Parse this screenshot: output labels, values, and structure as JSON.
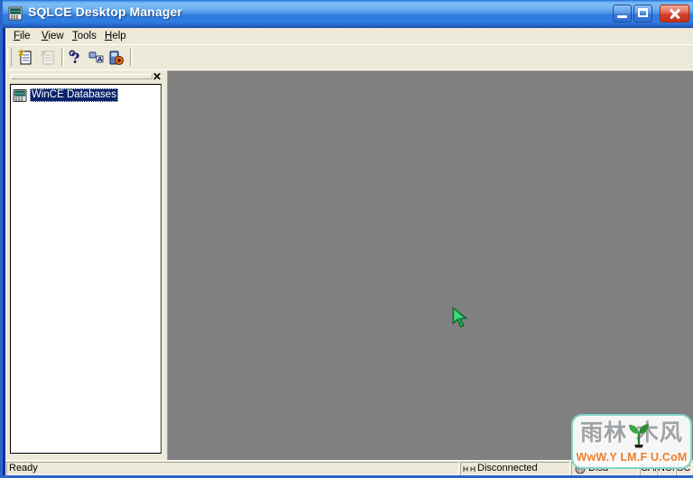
{
  "window": {
    "title": "SQLCE Desktop Manager",
    "icon": "handheld-device-icon",
    "buttons": {
      "minimize": "Minimize",
      "maximize": "Maximize",
      "close": "Close"
    }
  },
  "menu": {
    "items": [
      {
        "label": "File",
        "mnemonic": "F",
        "rest": "ile"
      },
      {
        "label": "View",
        "mnemonic": "V",
        "rest": "iew"
      },
      {
        "label": "Tools",
        "mnemonic": "T",
        "rest": "ools"
      },
      {
        "label": "Help",
        "mnemonic": "H",
        "rest": "elp"
      }
    ]
  },
  "toolbar": {
    "buttons": [
      {
        "name": "new-database-button",
        "icon": "new-document-icon",
        "enabled": true
      },
      {
        "name": "open-database-button",
        "icon": "open-document-icon",
        "enabled": false
      },
      {
        "name": "help-button",
        "icon": "question-mark-icon",
        "enabled": true
      },
      {
        "name": "sql-query-button",
        "icon": "sql-query-icon",
        "enabled": true
      },
      {
        "name": "connect-database-button",
        "icon": "database-connect-icon",
        "enabled": true
      }
    ]
  },
  "tree_panel": {
    "close_label": "✕",
    "nodes": [
      {
        "label": "WinCE Databases",
        "icon": "wince-device-icon",
        "selected": true
      }
    ]
  },
  "status_bar": {
    "message": "Ready",
    "connection_primary": "Disconnected",
    "connection_secondary": "Disa",
    "indicators": {
      "caps": "CAP",
      "num": "NUM",
      "scrl": "SCRL"
    }
  },
  "watermark": {
    "text_cn": "雨林 木风",
    "url": "WwW.Y LM.F U.CoM"
  },
  "colors": {
    "title_bar_blue": "#2f7ddf",
    "workspace_grey": "#808080",
    "panel_face": "#ece9d8",
    "selection_blue": "#0a246a",
    "cursor_green": "#16a34a",
    "watermark_orange": "#f08030"
  }
}
